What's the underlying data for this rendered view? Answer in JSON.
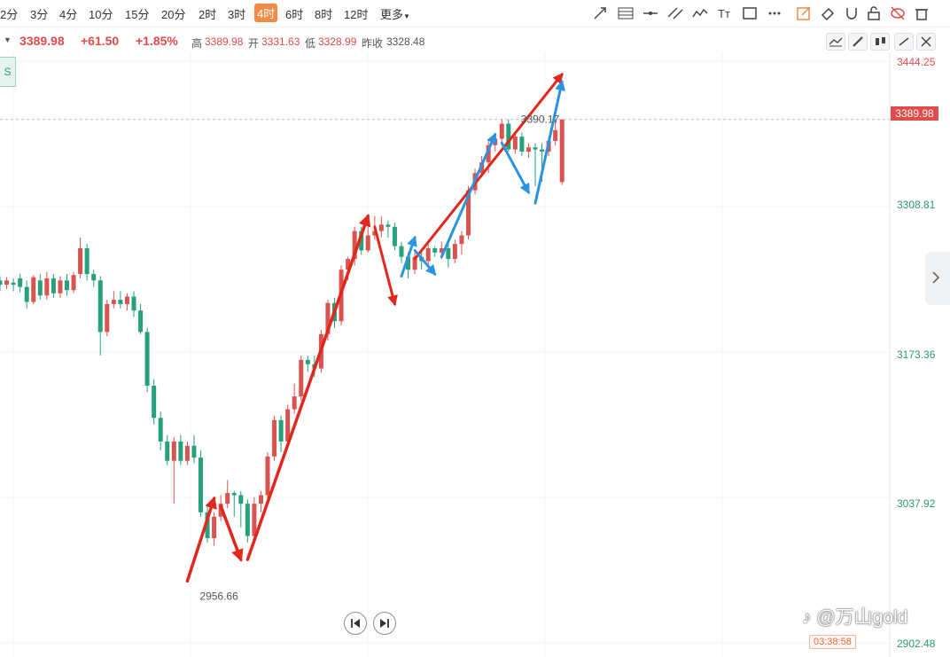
{
  "toolbar": {
    "timeframes": [
      "2分",
      "3分",
      "4分",
      "10分",
      "15分",
      "20分",
      "2时",
      "3时",
      "4时",
      "6时",
      "8时",
      "12时",
      "更多"
    ],
    "active_timeframe": "4时",
    "tools": [
      "trend-line-icon",
      "fibonacci-icon",
      "horizontal-line-icon",
      "parallel-channel-icon",
      "wave-icon",
      "text-tool-icon",
      "rectangle-icon",
      "more-tools-icon",
      "edit-icon",
      "eraser-icon",
      "magnet-icon",
      "lock-icon",
      "hide-icon",
      "trash-icon"
    ]
  },
  "info": {
    "price": "3389.98",
    "change": "+61.50",
    "change_pct": "+1.85%",
    "high_label": "高",
    "high": "3389.98",
    "open_label": "开",
    "open": "3331.63",
    "low_label": "低",
    "low": "3328.99",
    "prev_close_label": "昨收",
    "prev_close": "3328.48"
  },
  "left_tag": "S",
  "price_tag": "3389.98",
  "timer": "03:38:58",
  "watermark": "@万山gold",
  "colors": {
    "up": "#d9534f",
    "down": "#26a17b",
    "red_arrow": "#e0281e",
    "blue_arrow": "#2b93df"
  },
  "chart_data": {
    "type": "candlestick",
    "y_ticks": [
      3444.25,
      3308.81,
      3173.36,
      3037.92,
      2902.48
    ],
    "ylim": [
      2902.48,
      3444.25
    ],
    "last_price": 3389.98,
    "annotations": [
      {
        "label": "3390.17",
        "value": 3390.17
      },
      {
        "label": "2956.66",
        "value": 2956.66
      }
    ],
    "candles": [
      [
        3240,
        3236,
        3244,
        3230
      ],
      [
        3236,
        3240,
        3243,
        3232
      ],
      [
        3238,
        3236,
        3242,
        3230
      ],
      [
        3242,
        3234,
        3246,
        3229
      ],
      [
        3234,
        3220,
        3240,
        3214
      ],
      [
        3220,
        3243,
        3245,
        3218
      ],
      [
        3240,
        3226,
        3246,
        3222
      ],
      [
        3226,
        3242,
        3248,
        3222
      ],
      [
        3242,
        3228,
        3246,
        3224
      ],
      [
        3228,
        3240,
        3244,
        3224
      ],
      [
        3240,
        3231,
        3246,
        3226
      ],
      [
        3231,
        3245,
        3248,
        3228
      ],
      [
        3246,
        3270,
        3280,
        3242
      ],
      [
        3270,
        3246,
        3274,
        3240
      ],
      [
        3246,
        3240,
        3250,
        3234
      ],
      [
        3240,
        3192,
        3244,
        3170
      ],
      [
        3192,
        3218,
        3222,
        3188
      ],
      [
        3218,
        3222,
        3230,
        3214
      ],
      [
        3222,
        3218,
        3230,
        3214
      ],
      [
        3218,
        3225,
        3228,
        3212
      ],
      [
        3225,
        3212,
        3230,
        3206
      ],
      [
        3212,
        3192,
        3218,
        3190
      ],
      [
        3192,
        3142,
        3196,
        3136
      ],
      [
        3142,
        3112,
        3148,
        3106
      ],
      [
        3112,
        3090,
        3118,
        3082
      ],
      [
        3090,
        3072,
        3096,
        3068
      ],
      [
        3072,
        3090,
        3094,
        3032
      ],
      [
        3090,
        3072,
        3096,
        3068
      ],
      [
        3072,
        3086,
        3090,
        3068
      ],
      [
        3086,
        3075,
        3096,
        3070
      ],
      [
        3075,
        3024,
        3082,
        3020
      ],
      [
        3024,
        3000,
        3032,
        2996
      ],
      [
        3000,
        3020,
        3024,
        2993
      ],
      [
        3020,
        3032,
        3040,
        3016
      ],
      [
        3032,
        3042,
        3054,
        3028
      ],
      [
        3042,
        3040,
        3044,
        3020
      ],
      [
        3040,
        3032,
        3044,
        3010
      ],
      [
        3032,
        3002,
        3036,
        2996
      ],
      [
        3002,
        3032,
        3038,
        2998
      ],
      [
        3032,
        3040,
        3044,
        3024
      ],
      [
        3040,
        3076,
        3080,
        3036
      ],
      [
        3076,
        3110,
        3114,
        3072
      ],
      [
        3110,
        3090,
        3114,
        3080
      ],
      [
        3090,
        3120,
        3124,
        3086
      ],
      [
        3120,
        3132,
        3144,
        3116
      ],
      [
        3132,
        3166,
        3170,
        3128
      ],
      [
        3166,
        3162,
        3170,
        3155
      ],
      [
        3162,
        3158,
        3170,
        3150
      ],
      [
        3158,
        3190,
        3194,
        3154
      ],
      [
        3190,
        3219,
        3222,
        3184
      ],
      [
        3219,
        3202,
        3224,
        3196
      ],
      [
        3202,
        3250,
        3254,
        3198
      ],
      [
        3250,
        3260,
        3262,
        3240
      ],
      [
        3260,
        3286,
        3290,
        3254
      ],
      [
        3286,
        3268,
        3290,
        3264
      ],
      [
        3268,
        3282,
        3290,
        3266
      ],
      [
        3282,
        3286,
        3300,
        3278
      ],
      [
        3286,
        3292,
        3300,
        3280
      ],
      [
        3292,
        3290,
        3296,
        3280
      ],
      [
        3290,
        3272,
        3294,
        3268
      ],
      [
        3272,
        3262,
        3276,
        3256
      ],
      [
        3262,
        3250,
        3266,
        3242
      ],
      [
        3250,
        3262,
        3266,
        3246
      ],
      [
        3262,
        3258,
        3266,
        3250
      ],
      [
        3258,
        3270,
        3274,
        3254
      ],
      [
        3270,
        3266,
        3272,
        3262
      ],
      [
        3266,
        3270,
        3276,
        3260
      ],
      [
        3270,
        3260,
        3274,
        3252
      ],
      [
        3260,
        3274,
        3278,
        3256
      ],
      [
        3274,
        3282,
        3286,
        3264
      ],
      [
        3282,
        3324,
        3328,
        3278
      ],
      [
        3324,
        3340,
        3344,
        3320
      ],
      [
        3340,
        3350,
        3356,
        3336
      ],
      [
        3350,
        3366,
        3372,
        3340
      ],
      [
        3366,
        3372,
        3376,
        3360
      ],
      [
        3372,
        3386,
        3390,
        3368
      ],
      [
        3386,
        3362,
        3390,
        3360
      ],
      [
        3362,
        3374,
        3378,
        3358
      ],
      [
        3374,
        3360,
        3378,
        3356
      ],
      [
        3360,
        3364,
        3368,
        3354
      ],
      [
        3364,
        3362,
        3368,
        3328
      ],
      [
        3362,
        3360,
        3368,
        3332
      ],
      [
        3360,
        3370,
        3374,
        3356
      ],
      [
        3370,
        3380,
        3390,
        3366
      ],
      [
        3331.63,
        3389.98,
        3389.98,
        3328.99
      ]
    ]
  }
}
